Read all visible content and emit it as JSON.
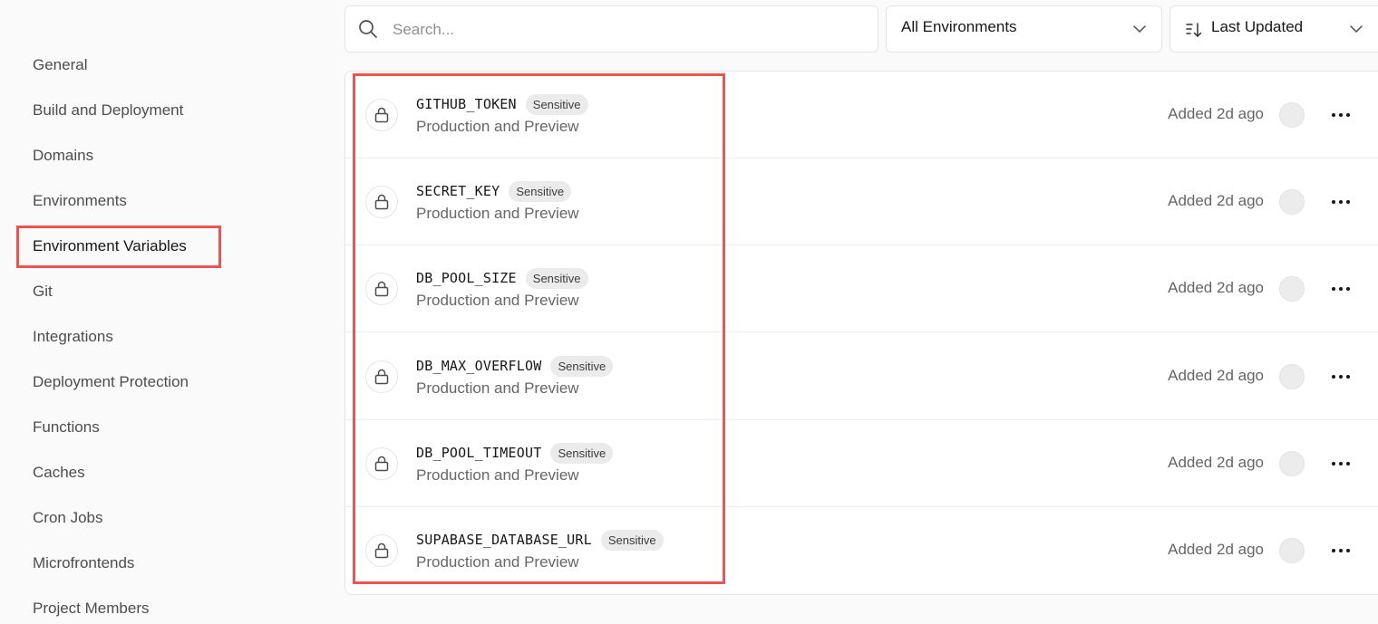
{
  "sidebar": {
    "items": [
      {
        "label": "General"
      },
      {
        "label": "Build and Deployment"
      },
      {
        "label": "Domains"
      },
      {
        "label": "Environments"
      },
      {
        "label": "Environment Variables",
        "active": true
      },
      {
        "label": "Git"
      },
      {
        "label": "Integrations"
      },
      {
        "label": "Deployment Protection"
      },
      {
        "label": "Functions"
      },
      {
        "label": "Caches"
      },
      {
        "label": "Cron Jobs"
      },
      {
        "label": "Microfrontends"
      },
      {
        "label": "Project Members"
      }
    ]
  },
  "toolbar": {
    "search_placeholder": "Search...",
    "environment_filter": "All Environments",
    "sort": "Last Updated"
  },
  "variables": [
    {
      "name": "GITHUB_TOKEN",
      "badge": "Sensitive",
      "environments": "Production and Preview",
      "added": "Added 2d ago"
    },
    {
      "name": "SECRET_KEY",
      "badge": "Sensitive",
      "environments": "Production and Preview",
      "added": "Added 2d ago"
    },
    {
      "name": "DB_POOL_SIZE",
      "badge": "Sensitive",
      "environments": "Production and Preview",
      "added": "Added 2d ago"
    },
    {
      "name": "DB_MAX_OVERFLOW",
      "badge": "Sensitive",
      "environments": "Production and Preview",
      "added": "Added 2d ago"
    },
    {
      "name": "DB_POOL_TIMEOUT",
      "badge": "Sensitive",
      "environments": "Production and Preview",
      "added": "Added 2d ago"
    },
    {
      "name": "SUPABASE_DATABASE_URL",
      "badge": "Sensitive",
      "environments": "Production and Preview",
      "added": "Added 2d ago"
    }
  ],
  "icons": {
    "search": "search-icon",
    "lock": "lock-icon",
    "chevron": "chevron-down-icon",
    "sort": "sort-icon",
    "more": "more-horizontal-icon"
  },
  "colors": {
    "highlight": "#ef5350",
    "text_primary": "#171717",
    "text_secondary": "#666666"
  }
}
